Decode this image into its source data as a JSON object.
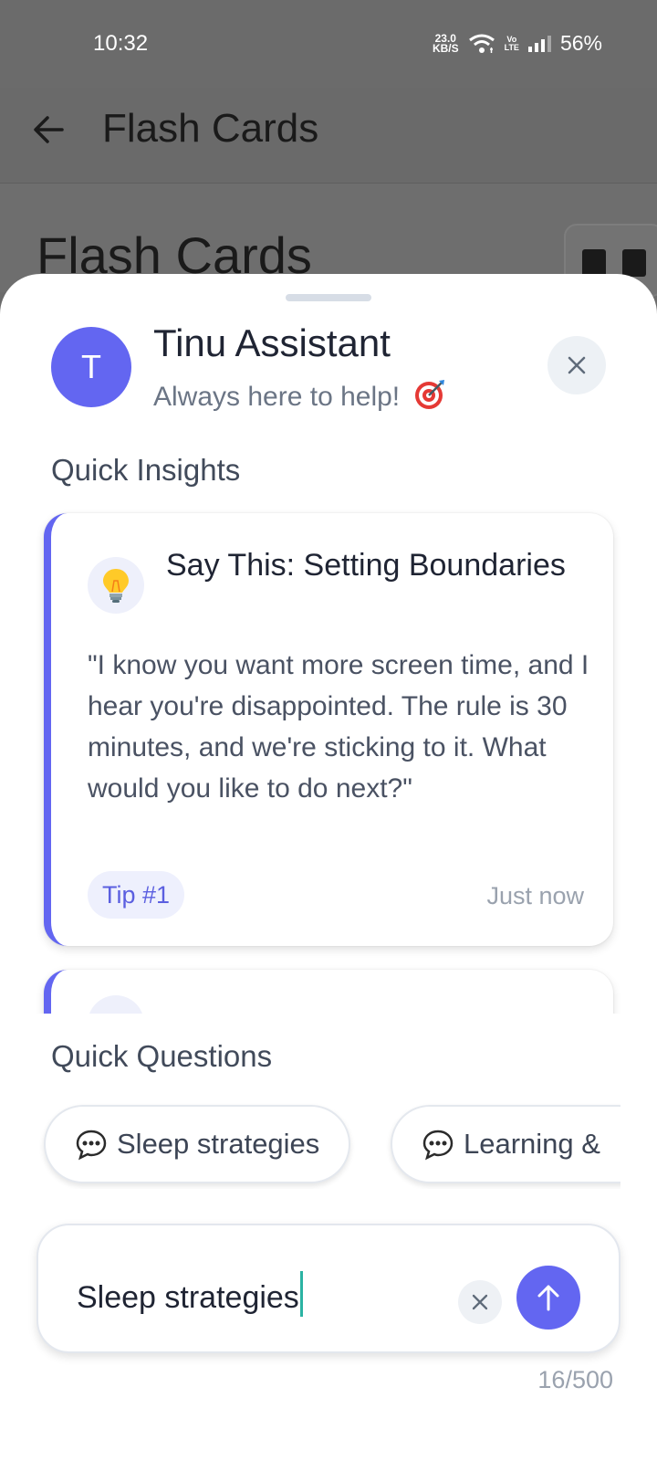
{
  "status_bar": {
    "time": "10:32",
    "net_speed_value": "23.0",
    "net_speed_unit": "KB/S",
    "volte_top": "Vo",
    "volte_bottom": "LTE",
    "battery": "56%"
  },
  "app_bar": {
    "title": "Flash Cards",
    "back_icon": "arrow-left-icon"
  },
  "background": {
    "heading": "Flash Cards"
  },
  "assistant": {
    "avatar_letter": "T",
    "name": "Tinu Assistant",
    "subtitle": "Always here to help!",
    "subtitle_icon": "target-icon",
    "close_icon": "close-icon"
  },
  "insights": {
    "section_label": "Quick Insights",
    "cards": [
      {
        "icon": "lightbulb-icon",
        "title": "Say This: Setting Boundaries",
        "body": "\"I know you want more screen time, and I hear you're disappointed. The rule is 30 minutes, and we're sticking to it. What would you like to do next?\"",
        "badge": "Tip #1",
        "time": "Just now"
      }
    ],
    "accent_color": "#6366f1"
  },
  "questions": {
    "section_label": "Quick Questions",
    "chips": [
      {
        "label": "Sleep strategies",
        "icon": "speech-bubble-icon"
      },
      {
        "label": "Learning &",
        "icon": "speech-bubble-icon"
      }
    ]
  },
  "composer": {
    "value": "Sleep strategies",
    "counter": "16/500",
    "send_color": "#6366f1"
  }
}
